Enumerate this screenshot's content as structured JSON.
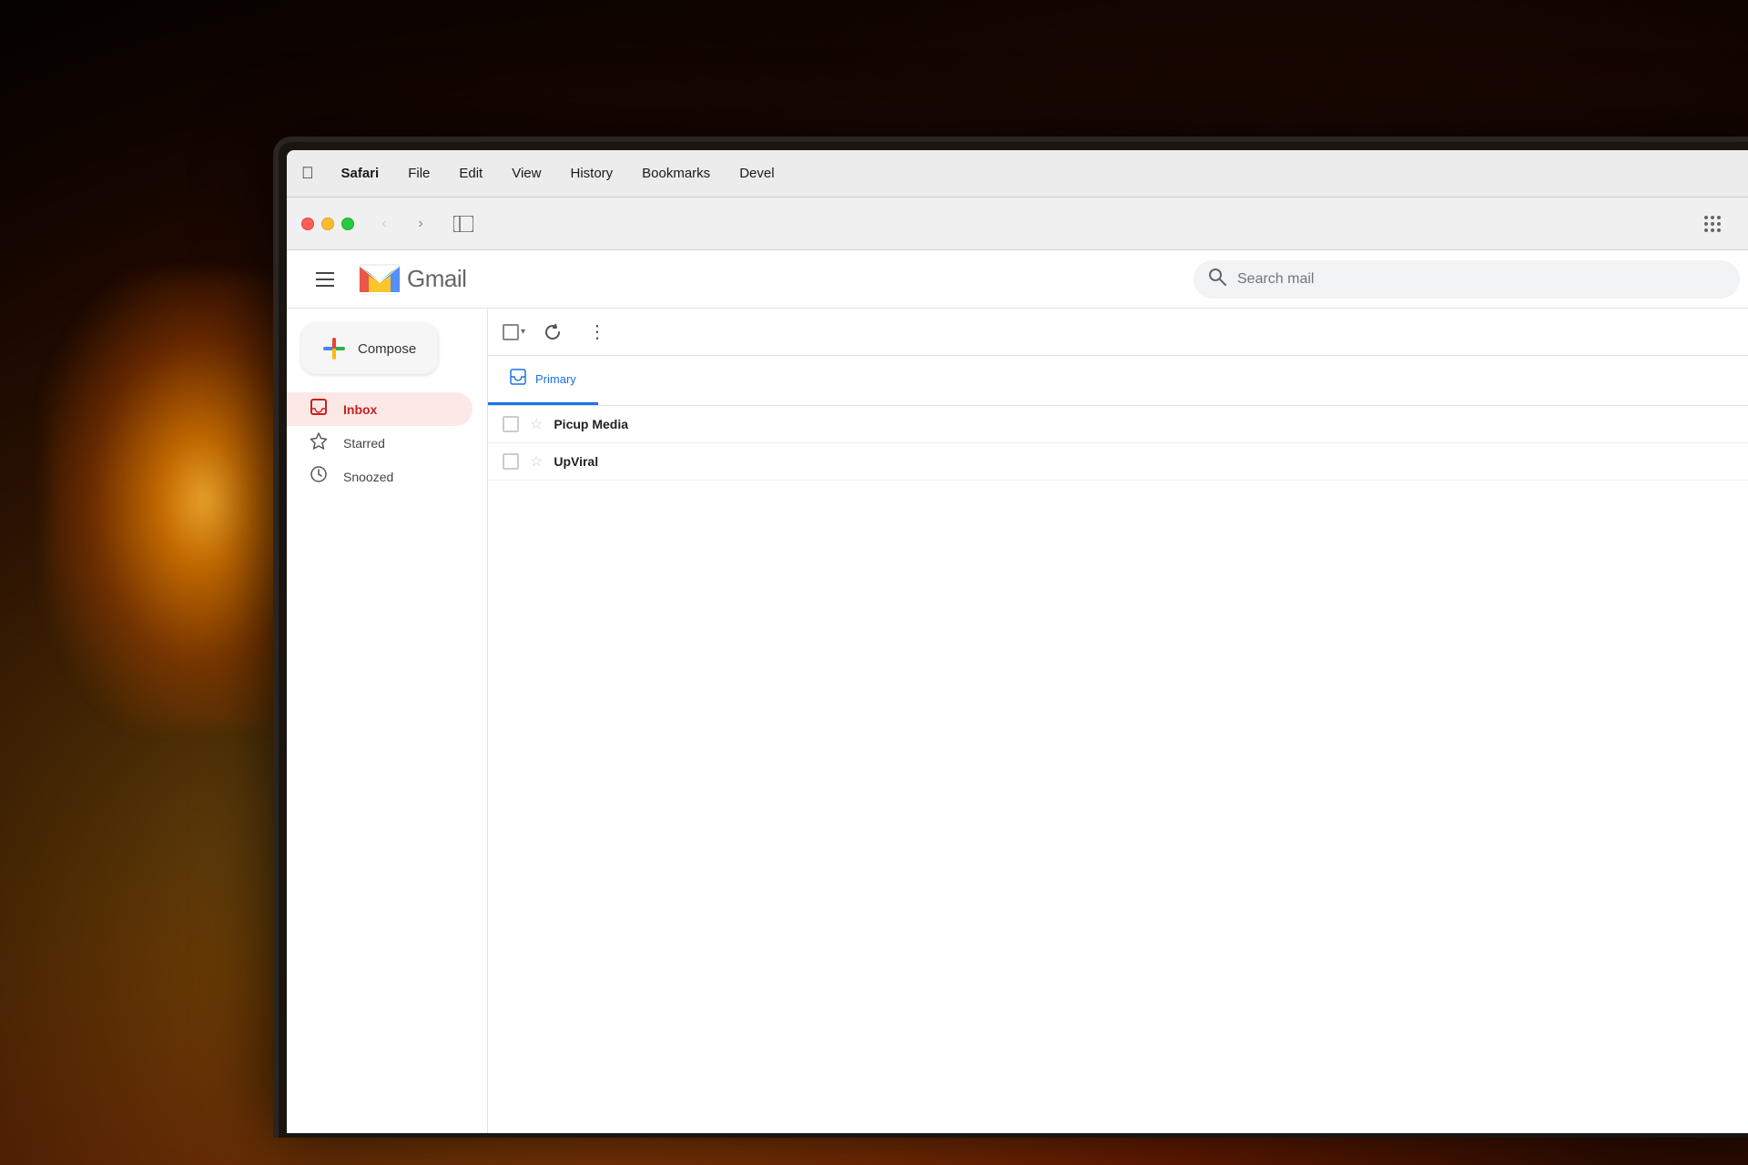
{
  "background": {
    "description": "Warm fireplace background photo"
  },
  "macos_menubar": {
    "apple_symbol": "🍎",
    "items": [
      {
        "id": "safari",
        "label": "Safari",
        "bold": true
      },
      {
        "id": "file",
        "label": "File"
      },
      {
        "id": "edit",
        "label": "Edit"
      },
      {
        "id": "view",
        "label": "View"
      },
      {
        "id": "history",
        "label": "History"
      },
      {
        "id": "bookmarks",
        "label": "Bookmarks"
      },
      {
        "id": "develop",
        "label": "Devel"
      }
    ]
  },
  "safari_toolbar": {
    "back_button": "‹",
    "forward_button": "›",
    "sidebar_icon": "⊡",
    "grid_icon": "⠿"
  },
  "gmail_header": {
    "logo_text": "Gmail",
    "search_placeholder": "Search mail"
  },
  "sidebar": {
    "compose_label": "Compose",
    "items": [
      {
        "id": "inbox",
        "label": "Inbox",
        "icon": "🔖",
        "active": true
      },
      {
        "id": "starred",
        "label": "Starred",
        "icon": "★"
      },
      {
        "id": "snoozed",
        "label": "Snoozed",
        "icon": "🕐"
      }
    ]
  },
  "email_tabs": [
    {
      "id": "primary",
      "label": "Primary",
      "icon": "□",
      "active": false
    }
  ],
  "email_rows": [
    {
      "id": "row1",
      "sender": "Picup Media",
      "star": "☆"
    },
    {
      "id": "row2",
      "sender": "UpViral",
      "star": "☆"
    }
  ],
  "toolbar": {
    "refresh_icon": "↻",
    "more_icon": "⋮"
  },
  "colors": {
    "gmail_red": "#c5221f",
    "gmail_blue": "#1a73e8",
    "active_bg": "#fce8e6",
    "compose_shadow": "rgba(0,0,0,0.15)"
  }
}
